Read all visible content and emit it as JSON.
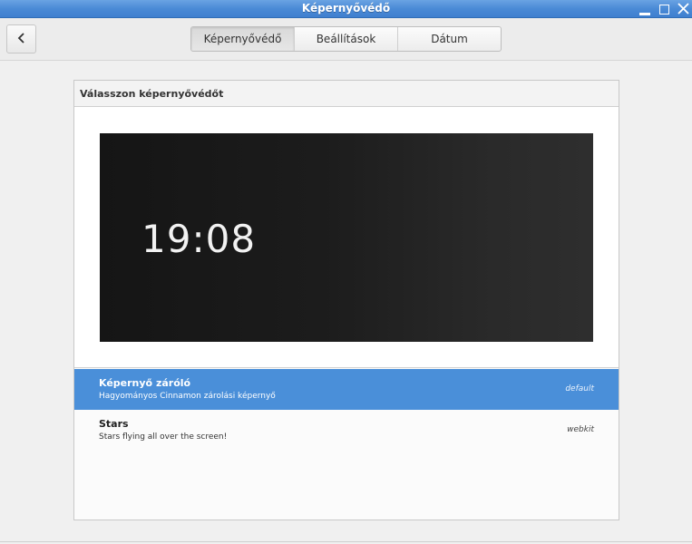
{
  "window": {
    "title": "Képernyővédő"
  },
  "header": {
    "tabs": [
      {
        "label": "Képernyővédő",
        "selected": true
      },
      {
        "label": "Beállítások",
        "selected": false
      },
      {
        "label": "Dátum",
        "selected": false
      }
    ]
  },
  "frame": {
    "title": "Válasszon képernyővédőt",
    "preview": {
      "clock": "19:08"
    },
    "items": [
      {
        "name": "Képernyő záróló",
        "description": "Hagyományos Cinnamon zárolási képernyő",
        "tag": "default",
        "selected": true
      },
      {
        "name": "Stars",
        "description": "Stars flying all over the screen!",
        "tag": "webkit",
        "selected": false
      }
    ]
  },
  "colors": {
    "accent": "#4a8fd9",
    "titlebar": "#4a8ad6"
  },
  "icons": {
    "back": "chevron-left-icon",
    "minimize": "minimize-icon",
    "maximize": "maximize-icon",
    "close": "close-icon"
  }
}
